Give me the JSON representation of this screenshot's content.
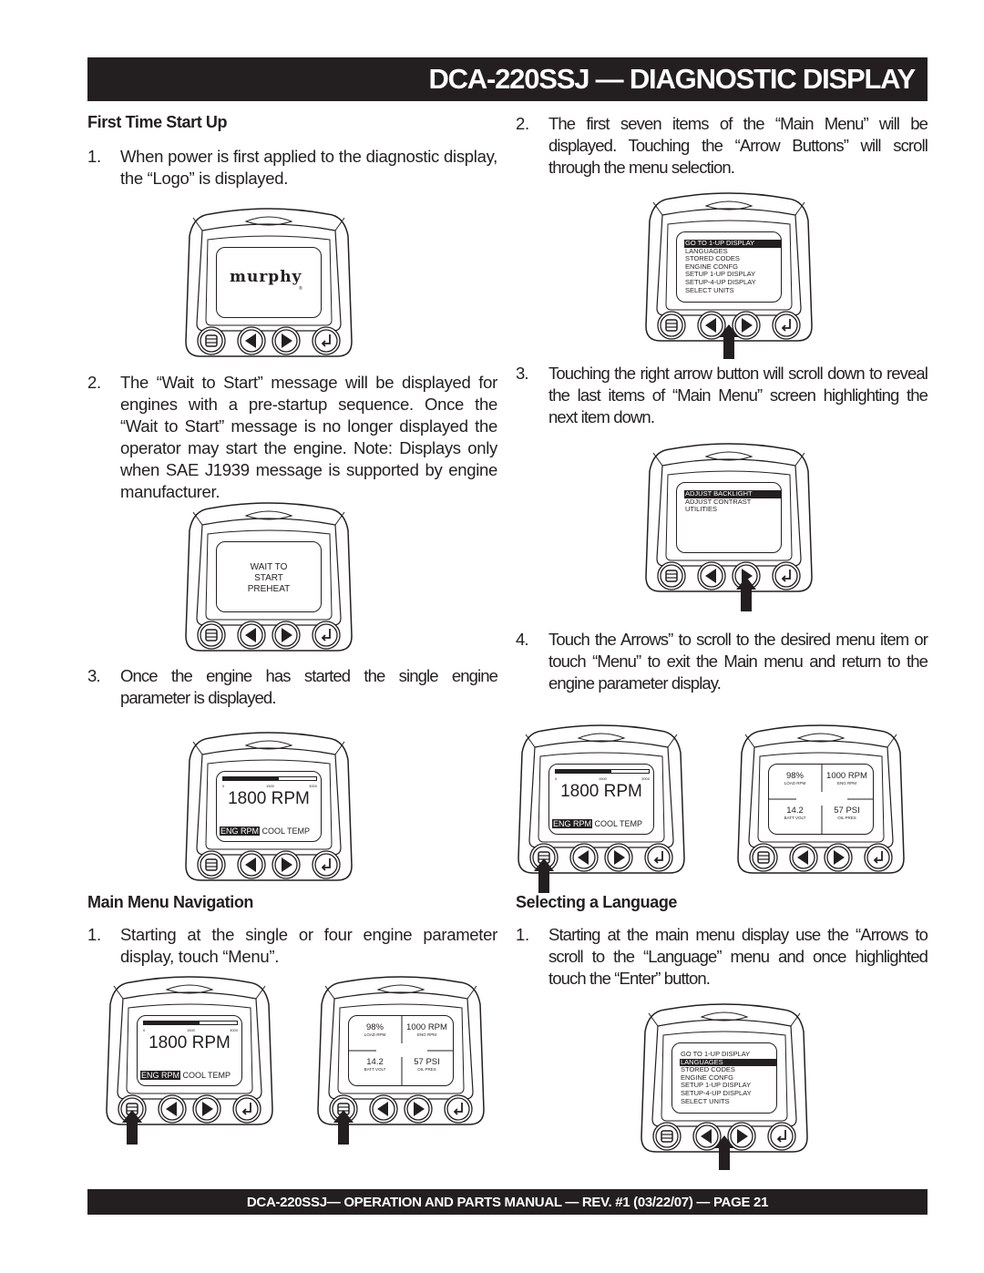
{
  "header": {
    "title": "DCA-220SSJ — DIAGNOSTIC DISPLAY"
  },
  "footer": {
    "text": "DCA-220SSJ— OPERATION AND PARTS MANUAL — REV. #1  (03/22/07) — PAGE 21"
  },
  "colors": {
    "bar": "#231f20",
    "text": "#231f20",
    "page": "#ffffff"
  },
  "first_time_start_up": {
    "heading": "First Time Start Up",
    "steps": [
      {
        "num": "1.",
        "text": "When power is first applied to the diagnostic display, the “Logo” is displayed."
      },
      {
        "num": "2.",
        "text": "The “Wait to Start” message will be displayed for engines with a pre-startup sequence. Once the “Wait to Start” message is no longer displayed the operator may start the engine. Note: Displays only when SAE J1939 message is supported by engine manufacturer."
      },
      {
        "num": "3.",
        "text": "Once the engine has started the single engine parameter is displayed."
      }
    ]
  },
  "right_steps": [
    {
      "num": "2.",
      "text": "The first seven items of the “Main Menu” will be displayed. Touching the “Arrow Buttons” will scroll through the menu selection."
    },
    {
      "num": "3.",
      "text": "Touching the right arrow button will scroll down to reveal the last items of “Main Menu” screen highlighting the next item down."
    },
    {
      "num": "4.",
      "text": "Touch the Arrows” to scroll to the desired menu item or touch “Menu” to exit the Main menu and return to the engine parameter display."
    }
  ],
  "main_menu_navigation": {
    "heading": "Main Menu Navigation",
    "steps": [
      {
        "num": "1.",
        "text": "Starting at the single or four engine parameter display, touch “Menu”."
      }
    ]
  },
  "selecting_language": {
    "heading": "Selecting a Language",
    "steps": [
      {
        "num": "1.",
        "text": "Starting at the main menu display use the “Arrows to scroll to the “Language” menu and once highlighted touch the “Enter” button."
      }
    ]
  },
  "screens": {
    "logo": {
      "brand": "murphy",
      "reg": "®"
    },
    "wait": {
      "lines": [
        "WAIT TO",
        "START",
        "PREHEAT"
      ]
    },
    "single_param": {
      "ticks": [
        "0",
        "1500",
        "3000"
      ],
      "rpm_fraction": 0.6,
      "value": "1800 RPM",
      "selected": "ENG RPM",
      "other": "COOL  TEMP"
    },
    "four_up": {
      "cells": [
        {
          "value": "98%",
          "label": "LOAD RPM"
        },
        {
          "value": "1000 RPM",
          "label": "ENG RPM"
        },
        {
          "value": "14.2",
          "label": "BATT VOLT"
        },
        {
          "value": "57 PSI",
          "label": "OIL PRES"
        }
      ]
    },
    "main_menu": {
      "items": [
        "GO TO 1-UP DISPLAY",
        "LANGUAGES",
        "STORED CODES",
        "ENGINE CONFG",
        "SETUP 1-UP DISPLAY",
        "SETUP-4-UP DISPLAY",
        "SELECT UNITS"
      ]
    },
    "main_menu_end": {
      "items": [
        "ADJUST BACKLIGHT",
        "ADJUST CONTRAST",
        "UTILITIES"
      ]
    }
  },
  "buttons": {
    "menu": "menu-button",
    "left": "left-arrow-button",
    "right": "right-arrow-button",
    "enter": "enter-button"
  }
}
